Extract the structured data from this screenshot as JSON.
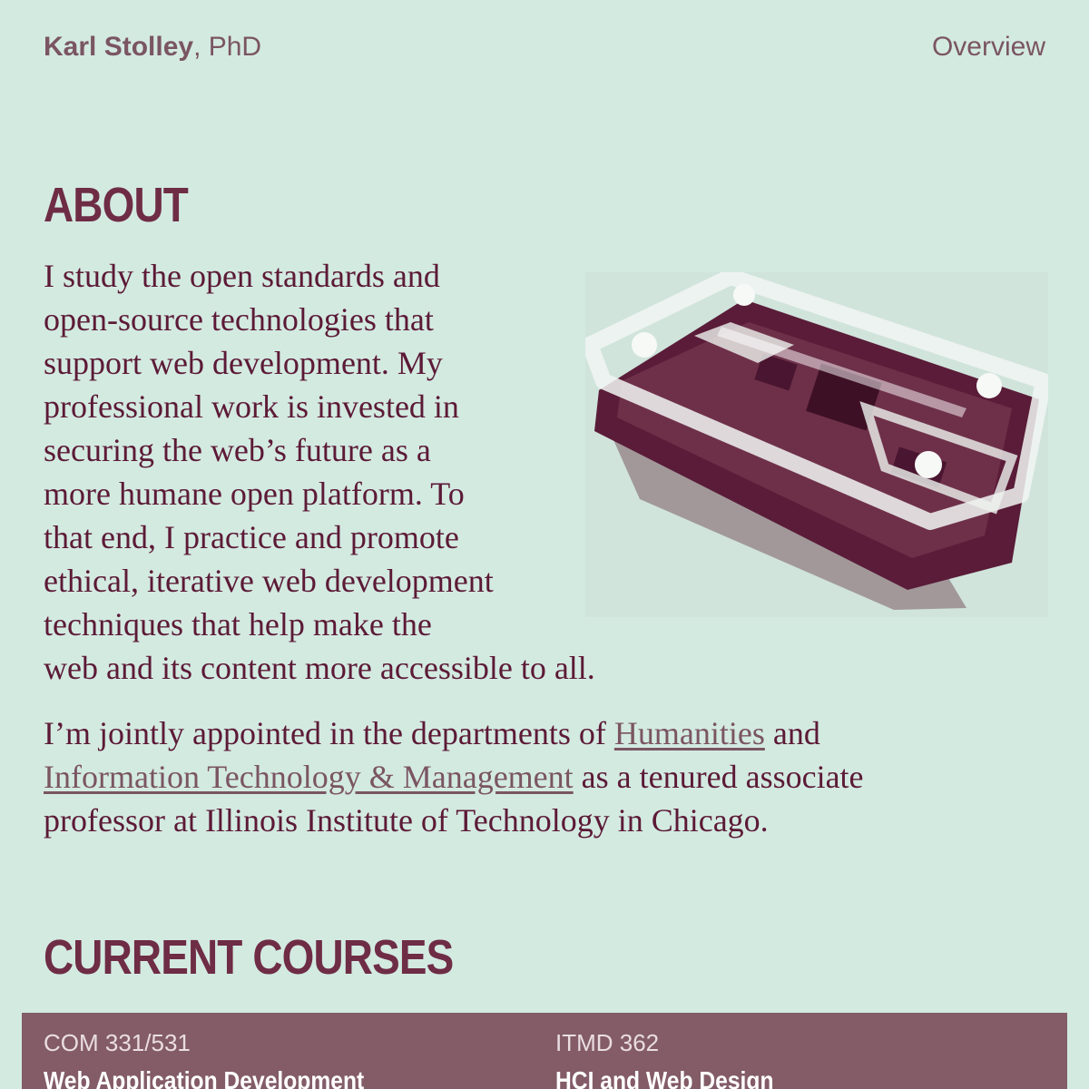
{
  "header": {
    "name": "Karl Stolley",
    "credential": ", PhD",
    "nav_overview": "Overview"
  },
  "about": {
    "heading": "ABOUT",
    "lines": [
      "I study the open standards and",
      "open-source technologies that",
      "support web development. My",
      "professional work is invested in",
      "securing the web’s future as a",
      "more humane open platform. To",
      "that end, I practice and promote",
      "ethical, iterative web development",
      "techniques that help make the",
      "web and its content more accessible to all."
    ],
    "para2": {
      "pre": "I’m jointly appointed in the departments of ",
      "link_humanities": "Humanities",
      "mid": " and",
      "link_itm": "Information Technology & Management",
      "post": " as a tenured associate",
      "line3": "professor at Illinois Institute of Technology in Chicago."
    }
  },
  "courses": {
    "heading": "CURRENT COURSES",
    "items": [
      {
        "code": "COM 331/531",
        "title": "Web Application Development"
      },
      {
        "code": "ITMD 362",
        "title": "HCI and Web Design"
      }
    ]
  },
  "colors": {
    "background": "#d3eae1",
    "text": "#5c1a36",
    "heading": "#6e2c45",
    "band": "#835c68"
  }
}
